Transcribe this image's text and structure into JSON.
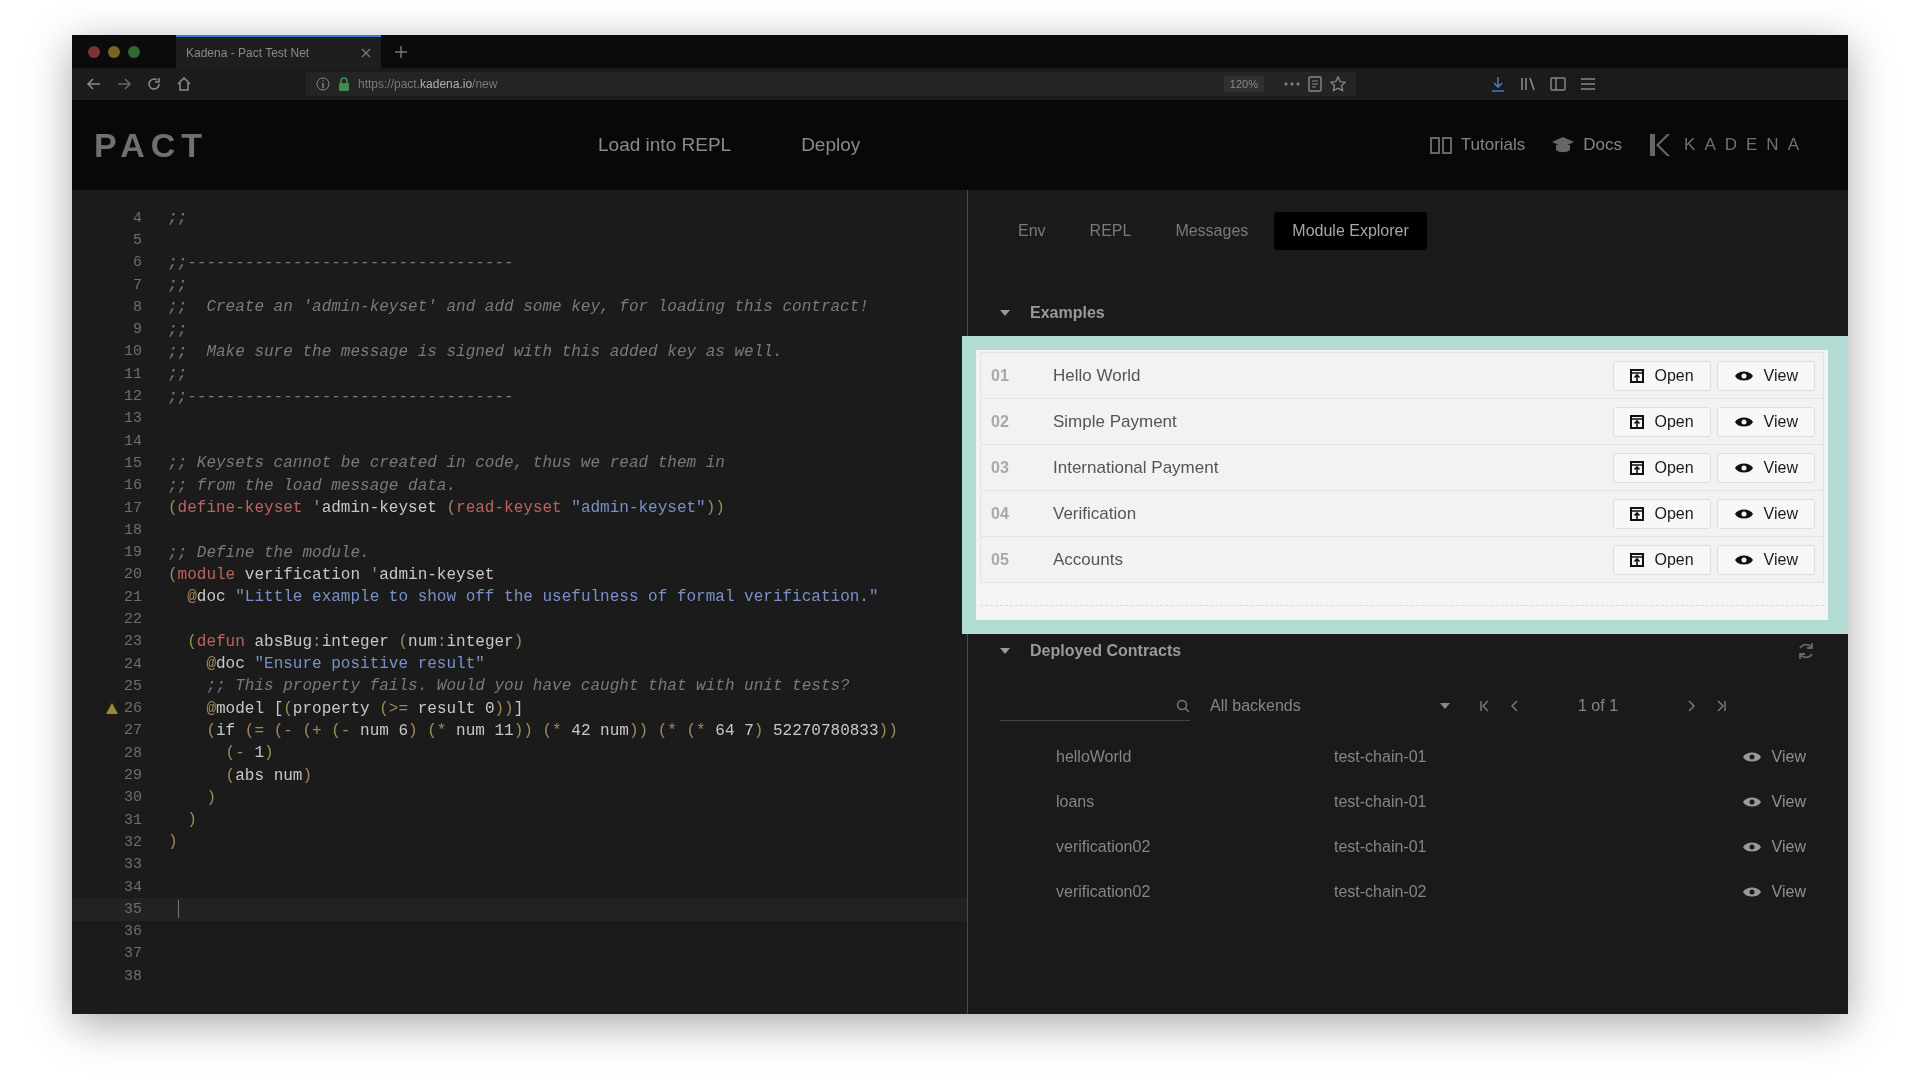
{
  "browser": {
    "tab_title": "Kadena - Pact Test Net",
    "url": "https://pact.**kadena.io**/new",
    "zoom": "120%"
  },
  "header": {
    "logo": "PACT",
    "nav": [
      "Load into REPL",
      "Deploy"
    ],
    "links": [
      {
        "label": "Tutorials",
        "kind": "book"
      },
      {
        "label": "Docs",
        "kind": "cap"
      }
    ],
    "brand": "KADENA"
  },
  "editor": {
    "lines": [
      {
        "number": "4",
        "tokens": [
          {
            "kind": "c",
            "text": ";;"
          }
        ]
      },
      {
        "number": "5"
      },
      {
        "number": "6",
        "tokens": [
          {
            "kind": "c",
            "text": ";;----------------------------------"
          }
        ]
      },
      {
        "number": "7",
        "tokens": [
          {
            "kind": "c",
            "text": ";;"
          }
        ]
      },
      {
        "number": "8",
        "tokens": [
          {
            "kind": "c",
            "text": ";;  Create an 'admin-keyset' and add some key, for loading this contract!"
          }
        ]
      },
      {
        "number": "9",
        "tokens": [
          {
            "kind": "c",
            "text": ";;"
          }
        ]
      },
      {
        "number": "10",
        "tokens": [
          {
            "kind": "c",
            "text": ";;  Make sure the message is signed with this added key as well."
          }
        ]
      },
      {
        "number": "11",
        "tokens": [
          {
            "kind": "c",
            "text": ";;"
          }
        ]
      },
      {
        "number": "12",
        "tokens": [
          {
            "kind": "c",
            "text": ";;----------------------------------"
          }
        ]
      },
      {
        "number": "13"
      },
      {
        "number": "14"
      },
      {
        "number": "15",
        "tokens": [
          {
            "kind": "c",
            "text": ";; Keysets cannot be created in code, thus we read them in"
          }
        ]
      },
      {
        "number": "16",
        "tokens": [
          {
            "kind": "c",
            "text": ";; from the load message data."
          }
        ]
      },
      {
        "number": "17",
        "tokens": [
          {
            "kind": "p",
            "text": "("
          },
          {
            "kind": "k",
            "text": "define-keyset"
          },
          {
            "kind": "p",
            "text": " '"
          },
          {
            "kind": "n",
            "text": "admin-keyset"
          },
          {
            "kind": "p",
            "text": " ("
          },
          {
            "kind": "k",
            "text": "read-keyset"
          },
          {
            "kind": "s",
            "text": " \"admin-keyset\""
          },
          {
            "kind": "p",
            "text": "))"
          }
        ]
      },
      {
        "number": "18"
      },
      {
        "number": "19",
        "tokens": [
          {
            "kind": "c",
            "text": ";; Define the module."
          }
        ]
      },
      {
        "number": "20",
        "tokens": [
          {
            "kind": "p",
            "text": "("
          },
          {
            "kind": "k",
            "text": "module"
          },
          {
            "kind": "n",
            "text": " verification"
          },
          {
            "kind": "p",
            "text": " '"
          },
          {
            "kind": "n",
            "text": "admin-keyset"
          }
        ]
      },
      {
        "number": "21",
        "tokens": [
          {
            "kind": "p",
            "text": "  @"
          },
          {
            "kind": "n",
            "text": "doc"
          },
          {
            "kind": "s",
            "text": " \"Little example to show off the usefulness of formal verification.\""
          }
        ]
      },
      {
        "number": "22"
      },
      {
        "number": "23",
        "tokens": [
          {
            "kind": "p",
            "text": "  ("
          },
          {
            "kind": "k",
            "text": "defun"
          },
          {
            "kind": "n",
            "text": " absBug"
          },
          {
            "kind": "p",
            "text": ":"
          },
          {
            "kind": "n",
            "text": "integer"
          },
          {
            "kind": "p",
            "text": " ("
          },
          {
            "kind": "n",
            "text": "num"
          },
          {
            "kind": "p",
            "text": ":"
          },
          {
            "kind": "n",
            "text": "integer"
          },
          {
            "kind": "p",
            "text": ")"
          }
        ]
      },
      {
        "number": "24",
        "tokens": [
          {
            "kind": "p",
            "text": "    @"
          },
          {
            "kind": "n",
            "text": "doc"
          },
          {
            "kind": "s",
            "text": " \"Ensure positive result\""
          }
        ]
      },
      {
        "number": "25",
        "tokens": [
          {
            "kind": "c",
            "text": "    ;; This property fails. Would you have caught that with unit tests?"
          }
        ]
      },
      {
        "number": "26",
        "warning": true,
        "tokens": [
          {
            "kind": "p",
            "text": "    @"
          },
          {
            "kind": "n",
            "text": "model ["
          },
          {
            "kind": "p",
            "text": "("
          },
          {
            "kind": "n",
            "text": "property"
          },
          {
            "kind": "p",
            "text": " (>= "
          },
          {
            "kind": "n",
            "text": "result 0"
          },
          {
            "kind": "p",
            "text": "))"
          },
          {
            "kind": "n",
            "text": "]"
          }
        ]
      },
      {
        "number": "27",
        "tokens": [
          {
            "kind": "p",
            "text": "    ("
          },
          {
            "kind": "n",
            "text": "if"
          },
          {
            "kind": "p",
            "text": " (= (- (+ (- "
          },
          {
            "kind": "n",
            "text": "num 6"
          },
          {
            "kind": "p",
            "text": ") (* "
          },
          {
            "kind": "n",
            "text": "num 11"
          },
          {
            "kind": "p",
            "text": ")) (* "
          },
          {
            "kind": "n",
            "text": "42 num"
          },
          {
            "kind": "p",
            "text": ")) (* (* "
          },
          {
            "kind": "n",
            "text": "64 7"
          },
          {
            "kind": "p",
            "text": ") "
          },
          {
            "kind": "n",
            "text": "52270780833"
          },
          {
            "kind": "p",
            "text": "))"
          }
        ]
      },
      {
        "number": "28",
        "tokens": [
          {
            "kind": "p",
            "text": "      (- "
          },
          {
            "kind": "n",
            "text": "1"
          },
          {
            "kind": "p",
            "text": ")"
          }
        ]
      },
      {
        "number": "29",
        "tokens": [
          {
            "kind": "p",
            "text": "      ("
          },
          {
            "kind": "n",
            "text": "abs num"
          },
          {
            "kind": "p",
            "text": ")"
          }
        ]
      },
      {
        "number": "30",
        "tokens": [
          {
            "kind": "p",
            "text": "    )"
          }
        ]
      },
      {
        "number": "31",
        "tokens": [
          {
            "kind": "p",
            "text": "  )"
          }
        ]
      },
      {
        "number": "32",
        "tokens": [
          {
            "kind": "p",
            "text": ")"
          }
        ]
      },
      {
        "number": "33"
      },
      {
        "number": "34"
      },
      {
        "number": "35",
        "active": true
      },
      {
        "number": "36"
      },
      {
        "number": "37"
      },
      {
        "number": "38"
      }
    ]
  },
  "panel": {
    "tabs": [
      {
        "label": "Env",
        "selected": false
      },
      {
        "label": "REPL",
        "selected": false
      },
      {
        "label": "Messages",
        "selected": false
      },
      {
        "label": "Module Explorer",
        "selected": true
      }
    ],
    "examples": {
      "title": "Examples",
      "expanded": true,
      "rows": [
        {
          "number": "01",
          "name": "Hello World",
          "open": "Open",
          "view": "View"
        },
        {
          "number": "02",
          "name": "Simple Payment",
          "open": "Open",
          "view": "View"
        },
        {
          "number": "03",
          "name": "International Payment",
          "open": "Open",
          "view": "View"
        },
        {
          "number": "04",
          "name": "Verification",
          "open": "Open",
          "view": "View"
        },
        {
          "number": "05",
          "name": "Accounts",
          "open": "Open",
          "view": "View"
        }
      ]
    },
    "deployed": {
      "title": "Deployed Contracts",
      "expanded": true,
      "backend": "All backends",
      "page": "1 of 1",
      "rows": [
        {
          "name": "helloWorld",
          "chain": "test-chain-01",
          "view": "View"
        },
        {
          "name": "loans",
          "chain": "test-chain-01",
          "view": "View"
        },
        {
          "name": "verification02",
          "chain": "test-chain-01",
          "view": "View"
        },
        {
          "name": "verification02",
          "chain": "test-chain-02",
          "view": "View"
        }
      ]
    }
  }
}
